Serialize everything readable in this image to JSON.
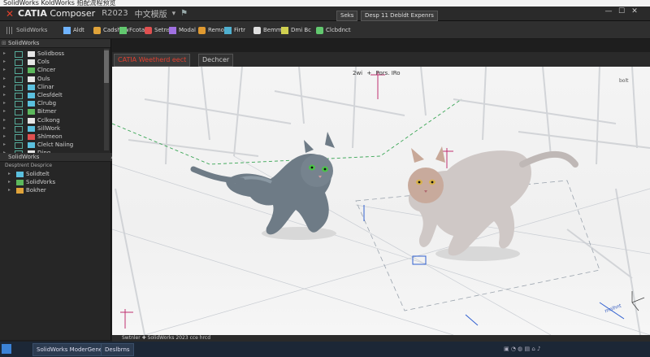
{
  "window": {
    "title": "SolidWorks KoldWorks 拍配流程预览"
  },
  "app": {
    "brand_prefix": "CATIA",
    "brand_rest": " Composer",
    "version": "R2023",
    "mode_label": "中文模版",
    "close_glyph": "✕",
    "cmd_tabs": [
      "Seks",
      "Desp 11 Debldt Expenrs"
    ]
  },
  "ribbon": {
    "items": [
      {
        "icon": "wrench-icon",
        "label": "Aldt",
        "color": "#6fb3ff"
      },
      {
        "icon": "solid-icon",
        "label": "Cadshow",
        "color": "#e0a33a"
      },
      {
        "icon": "sketch-icon",
        "label": "Fcotal",
        "color": "#62c86f"
      },
      {
        "icon": "plane-icon",
        "label": "Setns",
        "color": "#e05050"
      },
      {
        "icon": "feature-icon",
        "label": "Modal",
        "color": "#a070e0"
      },
      {
        "icon": "render-icon",
        "label": "Remote",
        "color": "#e09a30"
      },
      {
        "icon": "grid-icon",
        "label": "Firtr",
        "color": "#4fb0d0"
      },
      {
        "icon": "measure-icon",
        "label": "Bemm",
        "color": "#e0e0e0"
      },
      {
        "icon": "node-icon",
        "label": "Dmi Bc",
        "color": "#d0d050"
      },
      {
        "icon": "link-icon",
        "label": "Clcbdnct",
        "color": "#62c86f"
      }
    ]
  },
  "left_panel": {
    "header": "SolidWorks",
    "tree": [
      {
        "label": "Solidboss",
        "color": "#e6e6e6"
      },
      {
        "label": "Cols",
        "color": "#e6e6e6"
      },
      {
        "label": "Clncer",
        "color": "#5cb85c"
      },
      {
        "label": "Ouls",
        "color": "#e6e6e6"
      },
      {
        "label": "Clinar",
        "color": "#5bc0de"
      },
      {
        "label": "Clesfdelt",
        "color": "#5bc0de"
      },
      {
        "label": "Clrubg",
        "color": "#5bc0de"
      },
      {
        "label": "Bitmer",
        "color": "#5cb85c"
      },
      {
        "label": "Cclkong",
        "color": "#e6e6e6"
      },
      {
        "label": "SillWork",
        "color": "#5bc0de"
      },
      {
        "label": "Shlmeon",
        "color": "#e05050"
      },
      {
        "label": "Clelct Naiing",
        "color": "#5bc0de"
      },
      {
        "label": "Ding",
        "color": "#e6e6e6"
      }
    ],
    "section2_header": "SolidWorks",
    "section2_sub": "Desptrent Desprice",
    "section2_items": [
      {
        "label": "Solidtelt",
        "color": "#5bc0de"
      },
      {
        "label": "SolidVorks",
        "color": "#5cb85c"
      },
      {
        "label": "Bokher",
        "color": "#e0a33a"
      }
    ]
  },
  "doc": {
    "tab_active": "CATIA Weetherd eect",
    "tab_other": "Dechcer"
  },
  "viewport": {
    "dim_label": "2wi",
    "dim_label2": "Pors. IRo",
    "corner_label": "bolt",
    "plane_label": "mnlhnt"
  },
  "status": {
    "text": "Swtnler ✚ SolidWorks 2023 cce hrcd"
  },
  "taskbar": {
    "items": [
      "SolidWorks ModerGene",
      "Deslbrns"
    ]
  }
}
